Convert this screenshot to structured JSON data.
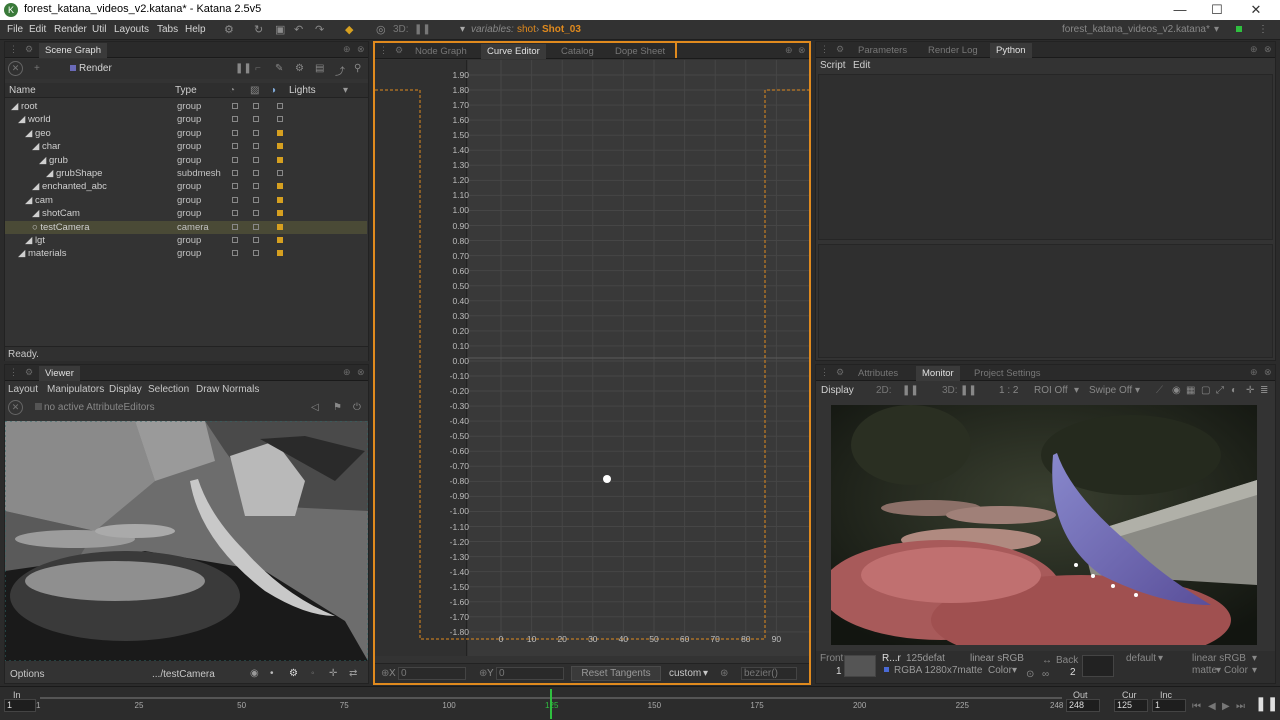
{
  "window": {
    "title": "forest_katana_videos_v2.katana* - Katana 2.5v5",
    "logo": "katana-logo-icon",
    "minimize": "—",
    "maximize": "☐",
    "close": "✕"
  },
  "menu": {
    "items": [
      "File",
      "Edit",
      "Render",
      "Util",
      "Layouts",
      "Tabs",
      "Help"
    ],
    "threeD_label": "3D:",
    "variables_label": "variables:",
    "shot_var": "shot",
    "shot_value": "Shot_03",
    "project_dropdown": "forest_katana_videos_v2.katana*"
  },
  "scene_graph": {
    "tab": "Scene Graph",
    "render_button": "Render",
    "columns": [
      "Name",
      "Type",
      "Lights"
    ],
    "rows": [
      {
        "name": "root",
        "type": "group",
        "depth": 0
      },
      {
        "name": "world",
        "type": "group",
        "depth": 1
      },
      {
        "name": "geo",
        "type": "group",
        "depth": 2
      },
      {
        "name": "char",
        "type": "group",
        "depth": 3
      },
      {
        "name": "grub",
        "type": "group",
        "depth": 4
      },
      {
        "name": "grubShape",
        "type": "subdmesh",
        "depth": 5
      },
      {
        "name": "enchanted_abc",
        "type": "group",
        "depth": 3
      },
      {
        "name": "cam",
        "type": "group",
        "depth": 2
      },
      {
        "name": "shotCam",
        "type": "group",
        "depth": 3
      },
      {
        "name": "testCamera",
        "type": "camera",
        "depth": 3
      },
      {
        "name": "lgt",
        "type": "group",
        "depth": 2
      },
      {
        "name": "materials",
        "type": "group",
        "depth": 1
      }
    ],
    "status": "Ready."
  },
  "viewer": {
    "tab": "Viewer",
    "menus": [
      "Layout",
      "Manipulators",
      "Display",
      "Selection",
      "Draw Normals"
    ],
    "no_editors": "no active AttributeEditors",
    "options": "Options",
    "camera_path": ".../testCamera"
  },
  "center": {
    "tabs": [
      "Node Graph",
      "Curve Editor",
      "Catalog",
      "Dope Sheet"
    ],
    "active_tab": "Curve Editor",
    "y_ticks": [
      "1.90",
      "1.80",
      "1.70",
      "1.60",
      "1.50",
      "1.40",
      "1.30",
      "1.20",
      "1.10",
      "1.00",
      "0.90",
      "0.80",
      "0.70",
      "0.60",
      "0.50",
      "0.40",
      "0.30",
      "0.20",
      "0.10",
      "0.00",
      "-0.10",
      "-0.20",
      "-0.30",
      "-0.40",
      "-0.50",
      "-0.60",
      "-0.70",
      "-0.80",
      "-0.90",
      "-1.00",
      "-1.10",
      "-1.20",
      "-1.30",
      "-1.40",
      "-1.50",
      "-1.60",
      "-1.70",
      "-1.80"
    ],
    "x_ticks": [
      "0",
      "10",
      "20",
      "30",
      "40",
      "50",
      "60",
      "70",
      "80",
      "90"
    ],
    "x_label": "X",
    "x_value": "0",
    "y_label": "Y",
    "y_value": "0",
    "reset_tangents": "Reset Tangents",
    "custom_dropdown": "custom",
    "bezier_field": "bezier()"
  },
  "right_top": {
    "tabs": [
      "Parameters",
      "Render Log",
      "Python"
    ],
    "active_tab": "Python",
    "menus": [
      "Script",
      "Edit"
    ]
  },
  "monitor": {
    "tabs": [
      "Attributes",
      "Monitor",
      "Project Settings"
    ],
    "active_tab": "Monitor",
    "display_label": "Display",
    "twoD": "2D:",
    "threeD": "3D:",
    "ratio": "1 : 2",
    "roi": "ROI Off",
    "swipe": "Swipe Off",
    "front_label": "Front",
    "front_num": "1",
    "channel": "R...r",
    "image_info": "125defat",
    "colorspace": "linear sRGB",
    "rgba_info": "RGBA 1280x7matte",
    "color_dd": "Color",
    "back_label": "Back",
    "back_num": "2",
    "default_dd": "default",
    "linear_dd": "linear sRGB",
    "matte_dd": "matte",
    "color_dd2": "Color"
  },
  "timeline": {
    "in_label": "In",
    "in_value": "1",
    "out_label": "Out",
    "out_value": "248",
    "cur_label": "Cur",
    "cur_value": "125",
    "inc_label": "Inc",
    "inc_value": "1",
    "ticks": [
      "1",
      "25",
      "50",
      "75",
      "100",
      "125",
      "150",
      "175",
      "200",
      "225",
      "248"
    ],
    "current_frame": 125,
    "start_frame": 1,
    "end_frame": 248
  },
  "colors": {
    "accent_orange": "#e08a1e",
    "timeline_cursor": "#2fbf3f",
    "light_icon": "#d6a020",
    "selected_row": "#4a4a36"
  }
}
